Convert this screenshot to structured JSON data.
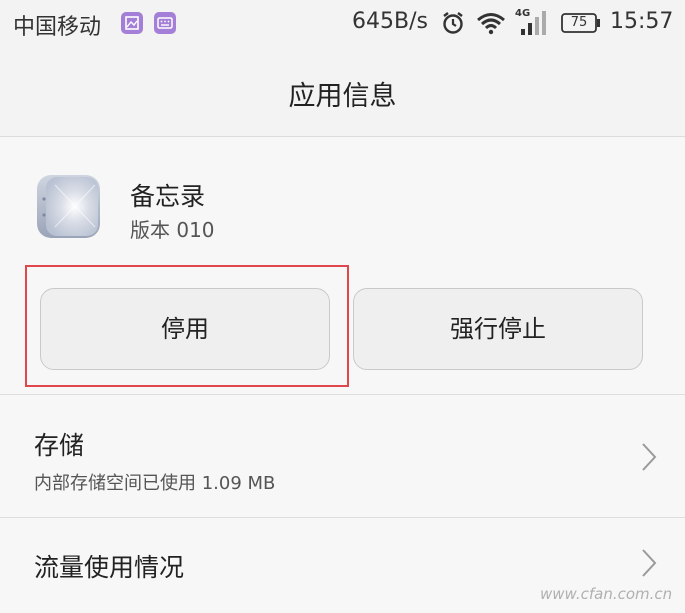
{
  "status_bar": {
    "carrier": "中国移动",
    "speed": "645B/s",
    "network": "4G",
    "battery": "75",
    "time": "15:57",
    "icons": [
      "image-notification-icon",
      "keyboard-notification-icon",
      "alarm-icon",
      "wifi-icon",
      "signal-icon",
      "battery-icon"
    ]
  },
  "header": {
    "title": "应用信息"
  },
  "app": {
    "name": "备忘录",
    "version": "版本 010",
    "icon": "notepad-app-icon"
  },
  "actions": {
    "disable_label": "停用",
    "force_stop_label": "强行停止"
  },
  "highlight_color": "#e0474d",
  "storage": {
    "title": "存储",
    "summary": "内部存储空间已使用 1.09 MB"
  },
  "data_usage": {
    "title": "流量使用情况"
  },
  "watermark": "www.cfan.com.cn"
}
